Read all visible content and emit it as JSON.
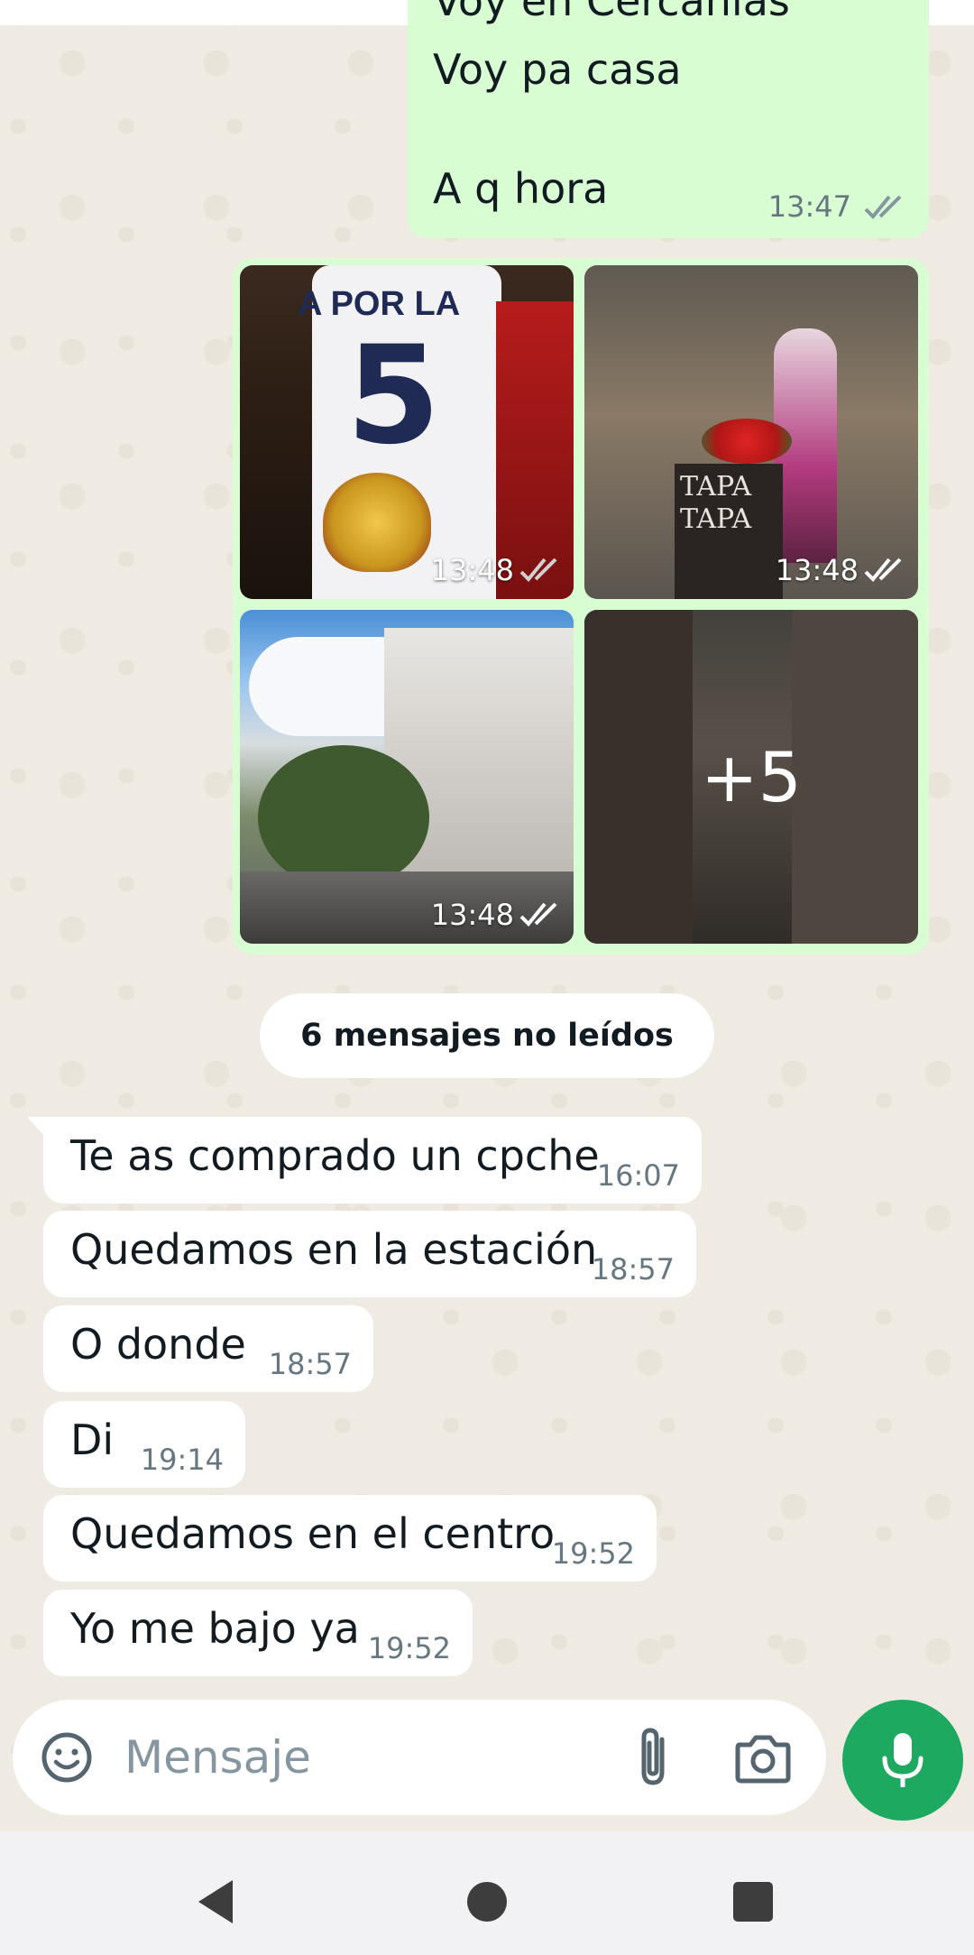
{
  "chat": {
    "outgoing_top": {
      "lines": [
        "Voy en Cercanias",
        "Voy pa casa",
        "A q hora"
      ],
      "time": "13:47",
      "status": "read"
    },
    "media_group": {
      "tiles": [
        {
          "time": "13:48",
          "status": "delivered",
          "shirt_text": "A POR LA",
          "shirt_number": "5"
        },
        {
          "time": "13:48",
          "status": "read",
          "sign_text_1": "TAPA",
          "sign_text_2": "TAPA"
        },
        {
          "time": "13:48",
          "status": "read"
        },
        {
          "more_count": "+5"
        }
      ]
    },
    "unread_divider": "6 mensajes no leídos",
    "incoming": [
      {
        "text": "Te as comprado un cpche",
        "time": "16:07"
      },
      {
        "text": "Quedamos en la estación",
        "time": "18:57"
      },
      {
        "text": "O donde",
        "time": "18:57"
      },
      {
        "text": "Di",
        "time": "19:14"
      },
      {
        "text": "Quedamos en el centro",
        "time": "19:52"
      },
      {
        "text": "Yo me bajo ya",
        "time": "19:52"
      }
    ]
  },
  "composer": {
    "placeholder": "Mensaje",
    "icons": [
      "emoji-icon",
      "paperclip-icon",
      "camera-icon",
      "microphone-icon"
    ]
  },
  "nav": {
    "icons": [
      "back-triangle-icon",
      "home-circle-icon",
      "recents-square-icon"
    ]
  },
  "colors": {
    "outgoing_bubble": "#d9fdd3",
    "incoming_bubble": "#ffffff",
    "wallpaper": "#efeae2",
    "mic_button": "#1da960",
    "read_ticks": "#ffffff",
    "timestamp": "#667781"
  }
}
